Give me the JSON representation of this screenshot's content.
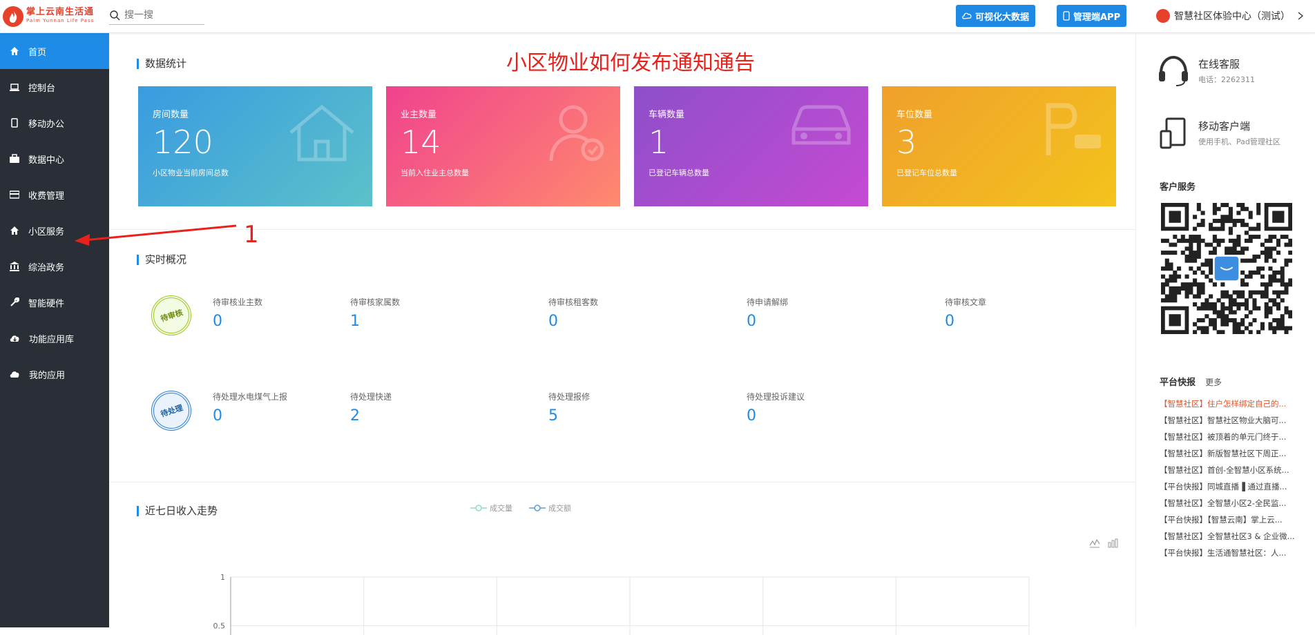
{
  "header": {
    "logo_cn": "掌上云南生活通",
    "logo_en": "Palm Yunnan Life Pass",
    "search_placeholder": "搜一搜",
    "btn_bigdata": "可视化大数据",
    "btn_app": "管理端APP",
    "user_label": "智慧社区体验中心（测试）",
    "accent": "#1e88e5"
  },
  "sidebar": {
    "bg": "#2a2f37",
    "items": [
      {
        "label": "首页",
        "icon": "home-icon"
      },
      {
        "label": "控制台",
        "icon": "laptop-icon"
      },
      {
        "label": "移动办公",
        "icon": "mobile-icon"
      },
      {
        "label": "数据中心",
        "icon": "briefcase-icon"
      },
      {
        "label": "收费管理",
        "icon": "card-icon"
      },
      {
        "label": "小区服务",
        "icon": "home-icon"
      },
      {
        "label": "综治政务",
        "icon": "bank-icon"
      },
      {
        "label": "智能硬件",
        "icon": "wrench-icon"
      },
      {
        "label": "功能应用库",
        "icon": "cloud-download-icon"
      },
      {
        "label": "我的应用",
        "icon": "cloud-icon"
      }
    ]
  },
  "annotation": {
    "title": "小区物业如何发布通知通告",
    "step": "1"
  },
  "stats_section": {
    "title": "数据统计",
    "cards": [
      {
        "label": "房间数量",
        "value": "120",
        "desc": "小区物业当前房间总数"
      },
      {
        "label": "业主数量",
        "value": "14",
        "desc": "当前入住业主总数量"
      },
      {
        "label": "车辆数量",
        "value": "1",
        "desc": "已登记车辆总数量"
      },
      {
        "label": "车位数量",
        "value": "3",
        "desc": "已登记车位总数量"
      }
    ]
  },
  "realtime": {
    "title": "实时概况",
    "stamp1": "待审核",
    "stamp2": "待处理",
    "row1": [
      {
        "label": "待审核业主数",
        "value": "0"
      },
      {
        "label": "待审核家属数",
        "value": "1"
      },
      {
        "label": "待审核租客数",
        "value": "0"
      },
      {
        "label": "待申请解绑",
        "value": "0"
      },
      {
        "label": "待审核文章",
        "value": "0"
      }
    ],
    "row2": [
      {
        "label": "待处理水电煤气上报",
        "value": "0"
      },
      {
        "label": "待处理快递",
        "value": "2"
      },
      {
        "label": "待处理报修",
        "value": "5"
      },
      {
        "label": "待处理投诉建议",
        "value": "0"
      }
    ]
  },
  "income": {
    "title": "近七日收入走势"
  },
  "chart_data": {
    "type": "line",
    "title": "近七日收入走势",
    "series": [
      {
        "name": "成交量",
        "values": []
      },
      {
        "name": "成交额",
        "values": []
      }
    ],
    "yticks": [
      "1",
      "0.5"
    ],
    "ylim": [
      0,
      1
    ],
    "grid": true,
    "legend": "top-center"
  },
  "right": {
    "service_title": "在线客服",
    "service_phone": "电话：2262311",
    "mobile_title": "移动客户端",
    "mobile_sub": "使用手机、Pad管理社区",
    "customer_service": "客户服务",
    "news_title": "平台快报",
    "news_more": "更多",
    "news": [
      "【智慧社区】住户怎样绑定自己的...",
      "【智慧社区】智慧社区物业大脑可...",
      "【智慧社区】被顶着的单元门终于...",
      "【智慧社区】新版智慧社区下周正...",
      "【智慧社区】首创-全智慧小区系统...",
      "【平台快报】同城直播▐ 通过直播...",
      "【智慧社区】全智慧小区2-全民监...",
      "【平台快报】【智慧云南】掌上云...",
      "【智慧社区】全智慧社区3 & 企业微...",
      "【平台快报】生活通智慧社区：人..."
    ]
  }
}
